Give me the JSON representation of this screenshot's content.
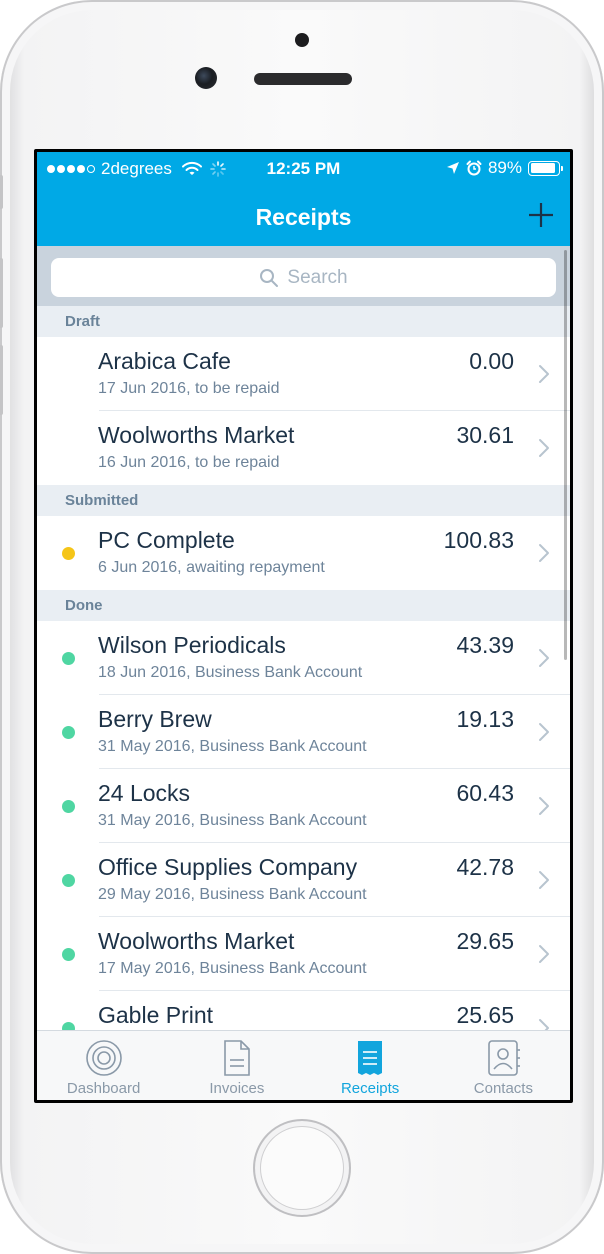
{
  "status_bar": {
    "carrier": "2degrees",
    "time": "12:25 PM",
    "battery": "89%",
    "battery_level": 0.89,
    "signal_bars": 4,
    "icons": [
      "wifi-icon",
      "loading-icon",
      "location-icon",
      "alarm-icon",
      "battery-icon"
    ]
  },
  "nav": {
    "title": "Receipts",
    "add_icon": "plus-icon"
  },
  "search": {
    "placeholder": "Search"
  },
  "sections": [
    {
      "title": "Draft",
      "items": [
        {
          "name": "Arabica Cafe",
          "detail": "17 Jun 2016, to be repaid",
          "amount": "0.00",
          "status": "none"
        },
        {
          "name": "Woolworths Market",
          "detail": "16 Jun 2016, to be repaid",
          "amount": "30.61",
          "status": "none"
        }
      ]
    },
    {
      "title": "Submitted",
      "items": [
        {
          "name": "PC Complete",
          "detail": "6 Jun 2016, awaiting repayment",
          "amount": "100.83",
          "status": "submitted"
        }
      ]
    },
    {
      "title": "Done",
      "items": [
        {
          "name": "Wilson Periodicals",
          "detail": "18 Jun 2016, Business Bank Account",
          "amount": "43.39",
          "status": "done"
        },
        {
          "name": "Berry Brew",
          "detail": "31 May 2016, Business Bank Account",
          "amount": "19.13",
          "status": "done"
        },
        {
          "name": "24 Locks",
          "detail": "31 May 2016, Business Bank Account",
          "amount": "60.43",
          "status": "done"
        },
        {
          "name": "Office Supplies Company",
          "detail": "29 May 2016, Business Bank Account",
          "amount": "42.78",
          "status": "done"
        },
        {
          "name": "Woolworths Market",
          "detail": "17 May 2016, Business Bank Account",
          "amount": "29.65",
          "status": "done"
        },
        {
          "name": "Gable Print",
          "detail": "",
          "amount": "25.65",
          "status": "done"
        }
      ]
    }
  ],
  "tabs": [
    {
      "label": "Dashboard",
      "icon": "dashboard-icon",
      "active": false
    },
    {
      "label": "Invoices",
      "icon": "invoice-icon",
      "active": false
    },
    {
      "label": "Receipts",
      "icon": "receipt-icon",
      "active": true
    },
    {
      "label": "Contacts",
      "icon": "contacts-icon",
      "active": false
    }
  ],
  "colors": {
    "brand": "#00a9e6",
    "submitted": "#f5c518",
    "done": "#4fd6a2",
    "tab_active": "#12a5dd",
    "tab_inactive": "#8a99a8"
  }
}
